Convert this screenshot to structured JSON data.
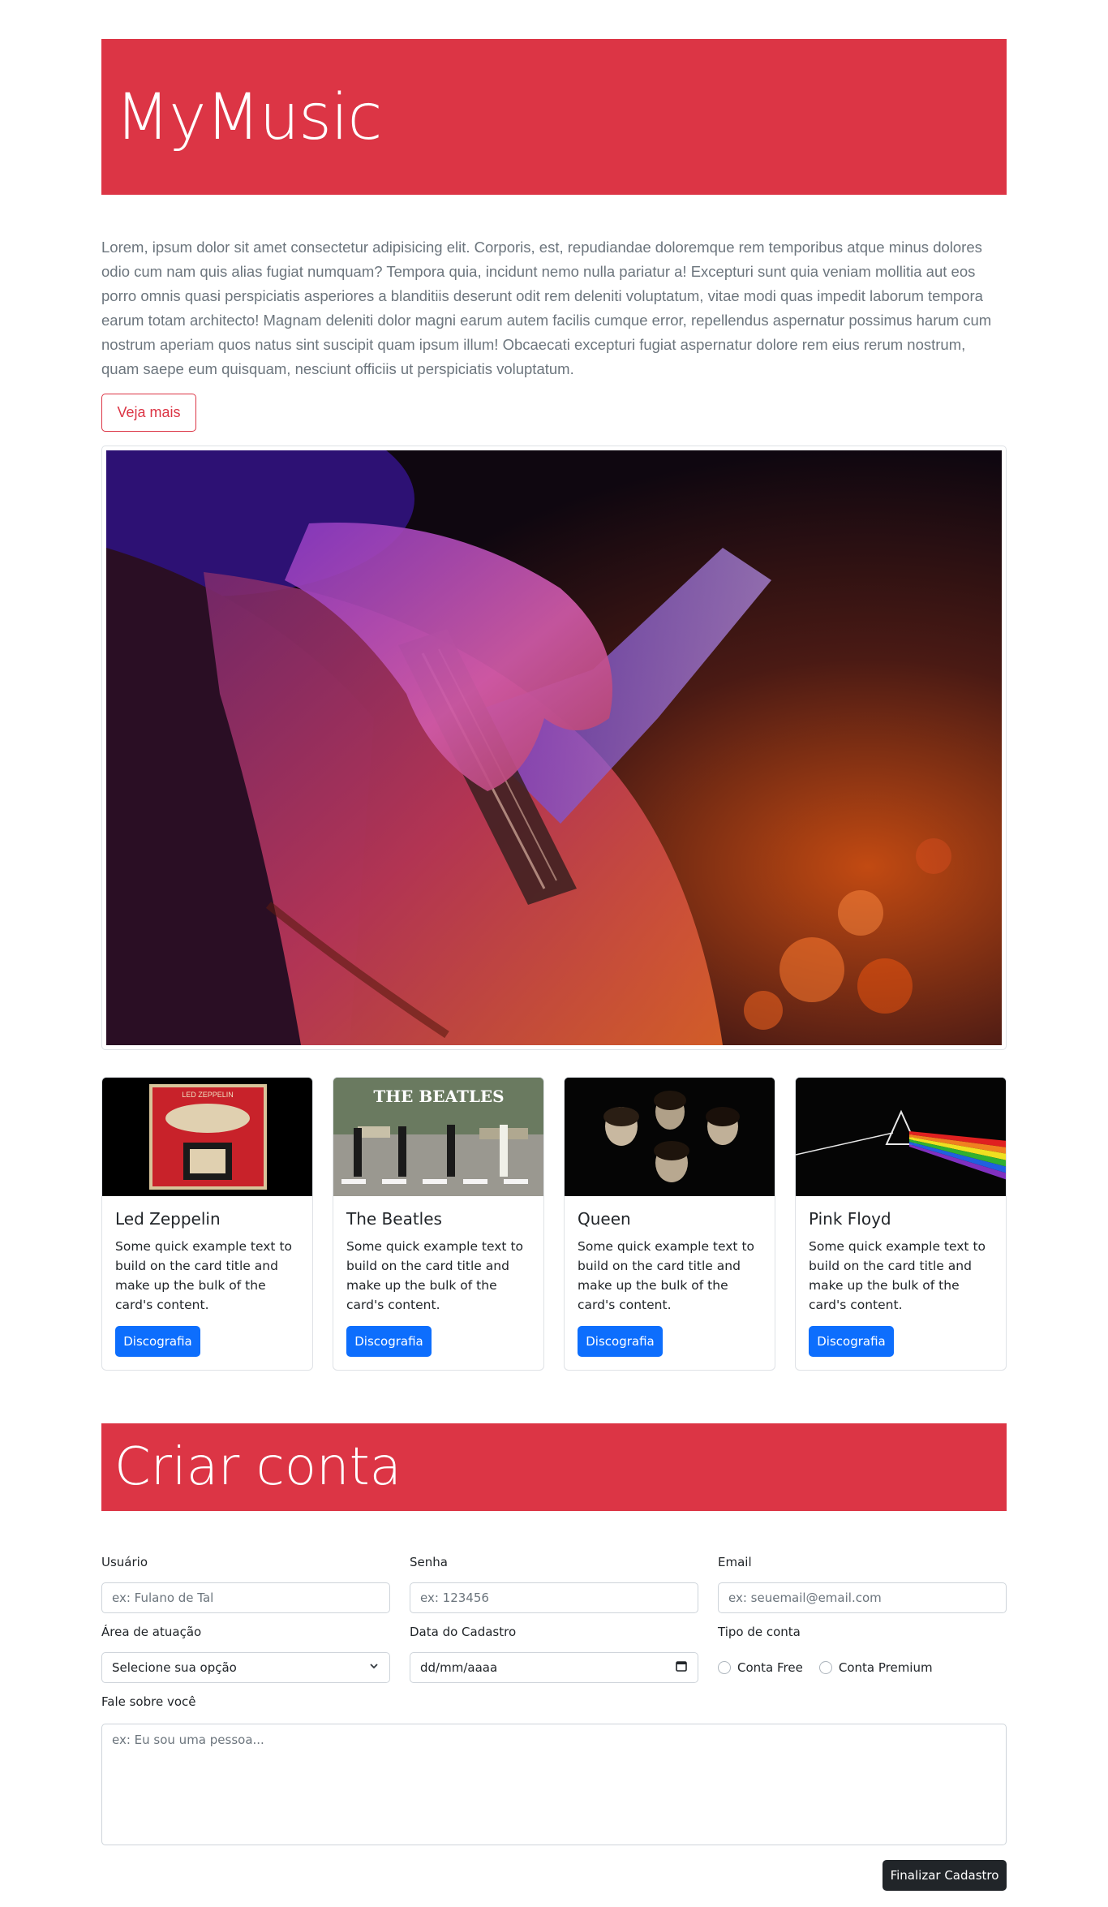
{
  "header": {
    "title": "MyMusic"
  },
  "intro": {
    "text": "Lorem, ipsum dolor sit amet consectetur adipisicing elit. Corporis, est, repudiandae doloremque rem temporibus atque minus dolores odio cum nam quis alias fugiat numquam? Tempora quia, incidunt nemo nulla pariatur a! Excepturi sunt quia veniam mollitia aut eos porro omnis quasi perspiciatis asperiores a blanditiis deserunt odit rem deleniti voluptatum, vitae modi quas impedit laborum tempora earum totam architecto! Magnam deleniti dolor magni earum autem facilis cumque error, repellendus aspernatur possimus harum cum nostrum aperiam quos natus sint suscipit quam ipsum illum! Obcaecati excepturi fugiat aspernatur dolore rem eius rerum nostrum, quam saepe eum quisquam, nesciunt officiis ut perspiciatis voluptatum.",
    "button_label": "Veja mais"
  },
  "cards": [
    {
      "title": "Led Zeppelin",
      "text": "Some quick example text to build on the card title and make up the bulk of the card's content.",
      "button_label": "Discografia",
      "image_text": "LED ZEPPELIN"
    },
    {
      "title": "The Beatles",
      "text": "Some quick example text to build on the card title and make up the bulk of the card's content.",
      "button_label": "Discografia",
      "image_text": "THE BEATLES"
    },
    {
      "title": "Queen",
      "text": "Some quick example text to build on the card title and make up the bulk of the card's content.",
      "button_label": "Discografia"
    },
    {
      "title": "Pink Floyd",
      "text": "Some quick example text to build on the card title and make up the bulk of the card's content.",
      "button_label": "Discografia"
    }
  ],
  "signup": {
    "title": "Criar conta",
    "fields": {
      "usuario": {
        "label": "Usuário",
        "placeholder": "ex: Fulano de Tal"
      },
      "senha": {
        "label": "Senha",
        "placeholder": "ex: 123456"
      },
      "email": {
        "label": "Email",
        "placeholder": "ex: seuemail@email.com"
      },
      "area": {
        "label": "Área de atuação",
        "value": "Selecione sua opção"
      },
      "data": {
        "label": "Data do Cadastro",
        "value": "dd/mm/aaaa"
      },
      "tipo": {
        "label": "Tipo de conta",
        "options": [
          "Conta Free",
          "Conta Premium"
        ]
      },
      "sobre": {
        "label": "Fale sobre você",
        "placeholder": "ex: Eu sou uma pessoa..."
      }
    },
    "submit_label": "Finalizar Cadastro"
  },
  "colors": {
    "brand": "#dc3545",
    "primary": "#0d6efd",
    "dark": "#212529"
  }
}
